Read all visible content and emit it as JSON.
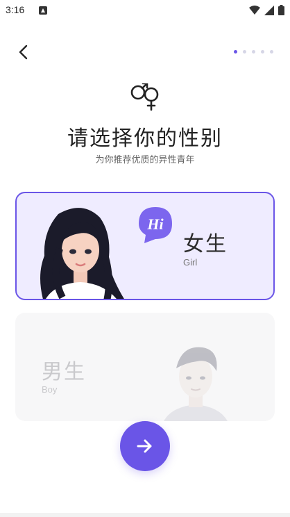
{
  "status_bar": {
    "time": "3:16"
  },
  "header": {
    "step_dots": 5,
    "active_step": 1
  },
  "main": {
    "title": "请选择你的性别",
    "subtitle": "为你推荐优质的异性青年"
  },
  "cards": {
    "female": {
      "label": "女生",
      "sub": "Girl",
      "badge": "Hi"
    },
    "male": {
      "label": "男生",
      "sub": "Boy"
    }
  },
  "colors": {
    "accent": "#6a55e7",
    "female_bg": "#efecff",
    "male_bg": "#f7f7f8"
  }
}
